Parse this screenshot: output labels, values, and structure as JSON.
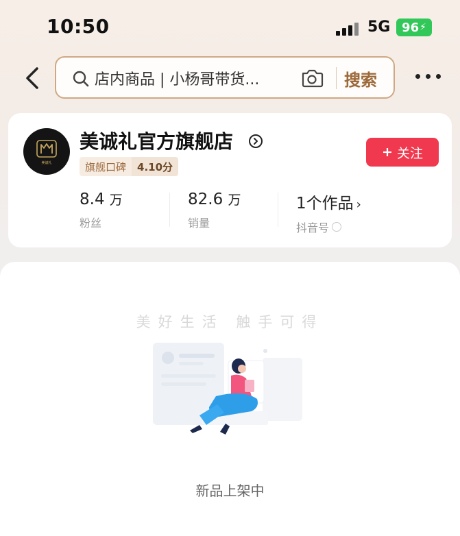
{
  "status_bar": {
    "time": "10:50",
    "network": "5G",
    "battery": "96"
  },
  "nav": {
    "search_text": "店内商品 | 小杨哥带货...",
    "search_button": "搜索"
  },
  "shop": {
    "name": "美诚礼官方旗舰店",
    "badge_label": "旗舰口碑",
    "badge_score": "4.10分",
    "follow_label": "关注",
    "logo_caption": "美诚礼",
    "stats": {
      "fans": {
        "value": "8.4",
        "unit": "万",
        "label": "粉丝"
      },
      "sales": {
        "value": "82.6",
        "unit": "万",
        "label": "销量"
      },
      "works": {
        "value": "1个作品",
        "label": "抖音号"
      }
    }
  },
  "products": {
    "slogan": "美好生活 触手可得",
    "empty_text": "新品上架中"
  },
  "colors": {
    "accent_red": "#f0394f",
    "search_border": "#cfa882",
    "search_button": "#9c6a3a",
    "battery_green": "#32c759"
  }
}
